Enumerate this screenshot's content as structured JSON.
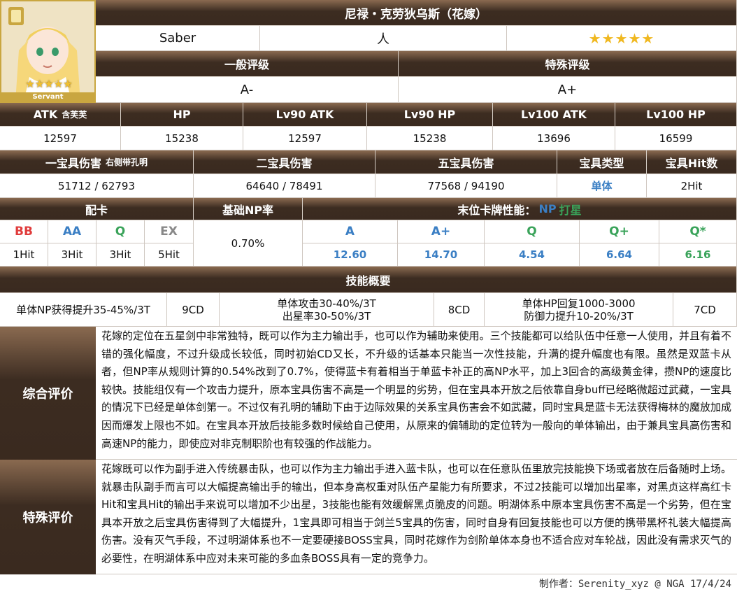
{
  "header": {
    "name": "尼禄・克劳狄乌斯（花嫁）",
    "class": "Saber",
    "attribute": "人",
    "rarity_stars": "★★★★★",
    "avatar_label": "Servant"
  },
  "rating": {
    "general_label": "一般评级",
    "special_label": "特殊评级",
    "general_value": "A-",
    "special_value": "A+"
  },
  "stats": {
    "headers": [
      "ATK",
      "HP",
      "Lv90 ATK",
      "Lv90 HP",
      "Lv100 ATK",
      "Lv100 HP"
    ],
    "atk_note": "含芙芙",
    "values": [
      "12597",
      "15238",
      "12597",
      "15238",
      "13696",
      "16599"
    ]
  },
  "np": {
    "headers": [
      "一宝具伤害",
      "二宝具伤害",
      "五宝具伤害",
      "宝具类型",
      "宝具Hit数"
    ],
    "np1_note": "右侧带孔明",
    "values": [
      "51712 / 62793",
      "64640 / 78491",
      "77568 / 94190",
      "单体",
      "2Hit"
    ]
  },
  "cards": {
    "deck_label": "配卡",
    "np_rate_label": "基础NP率",
    "perf_label": "末位卡牌性能：",
    "perf_np": "NP",
    "perf_star": "打星",
    "types": [
      "BB",
      "AA",
      "Q",
      "EX"
    ],
    "hits": [
      "1Hit",
      "3Hit",
      "3Hit",
      "5Hit"
    ],
    "np_rate": "0.70%",
    "perf_headers": [
      "A",
      "A+",
      "Q",
      "Q+",
      "Q*"
    ],
    "perf_values": [
      "12.60",
      "14.70",
      "4.54",
      "6.64",
      "6.16"
    ]
  },
  "skills": {
    "title": "技能概要",
    "s1": "单体NP获得提升35-45%/3T",
    "s1_cd": "9CD",
    "s2_line1": "单体攻击30-40%/3T",
    "s2_line2": "出星率30-50%/3T",
    "s2_cd": "8CD",
    "s3_line1": "单体HP回复1000-3000",
    "s3_line2": "防御力提升10-20%/3T",
    "s3_cd": "7CD"
  },
  "reviews": {
    "overall_label": "综合评价",
    "overall_text": "花嫁的定位在五星剑中非常独特，既可以作为主力输出手，也可以作为辅助来使用。三个技能都可以给队伍中任意一人使用，并且有着不错的强化幅度，不过升级成长较低，同时初始CD又长，不升级的话基本只能当一次性技能，升满的提升幅度也有限。虽然是双蓝卡从者，但NP率从规则计算的0.54%改到了0.7%，使得蓝卡有着相当于单蓝卡补正的高NP水平，加上3回合的高级黄金律，攒NP的速度比较快。技能组仅有一个攻击力提升，原本宝具伤害不高是一个明显的劣势，但在宝具本开放之后依靠自身buff已经略微超过武藏，一宝具的情况下已经是单体剑第一。不过仅有孔明的辅助下由于边际效果的关系宝具伤害会不如武藏，同时宝具是蓝卡无法获得梅林的魔放加成因而爆发上限也不如。在宝具本开放后技能多数时候给自己使用，从原来的偏辅助的定位转为一般向的单体输出，由于兼具宝具高伤害和高速NP的能力，即使应对非克制职阶也有较强的作战能力。",
    "special_label": "特殊评价",
    "special_text": "花嫁既可以作为副手进入传统暴击队，也可以作为主力输出手进入蓝卡队，也可以在任意队伍里放完技能换下场或者放在后备随时上场。就暴击队副手而言可以大幅提高输出手的输出，但本身高权重对队伍产星能力有所要求，不过2技能可以增加出星率，对黑贞这样高红卡Hit和宝具Hit的输出手来说可以增加不少出星，3技能也能有效缓解黑贞脆皮的问题。明湖体系中原本宝具伤害不高是一个劣势，但在宝具本开放之后宝具伤害得到了大幅提升，1宝具即可相当于剑兰5宝具的伤害，同时自身有回复技能也可以方便的携带黑杯礼装大幅提高伤害。没有灭气手段，不过明湖体系也不一定要硬接BOSS宝具，同时花嫁作为剑阶单体本身也不适合应对车轮战，因此没有需求灭气的必要性，在明湖体系中应对未来可能的多血条BOSS具有一定的竞争力。"
  },
  "footer": {
    "credit": "制作者：Serenity_xyz @ NGA  17/4/24"
  }
}
